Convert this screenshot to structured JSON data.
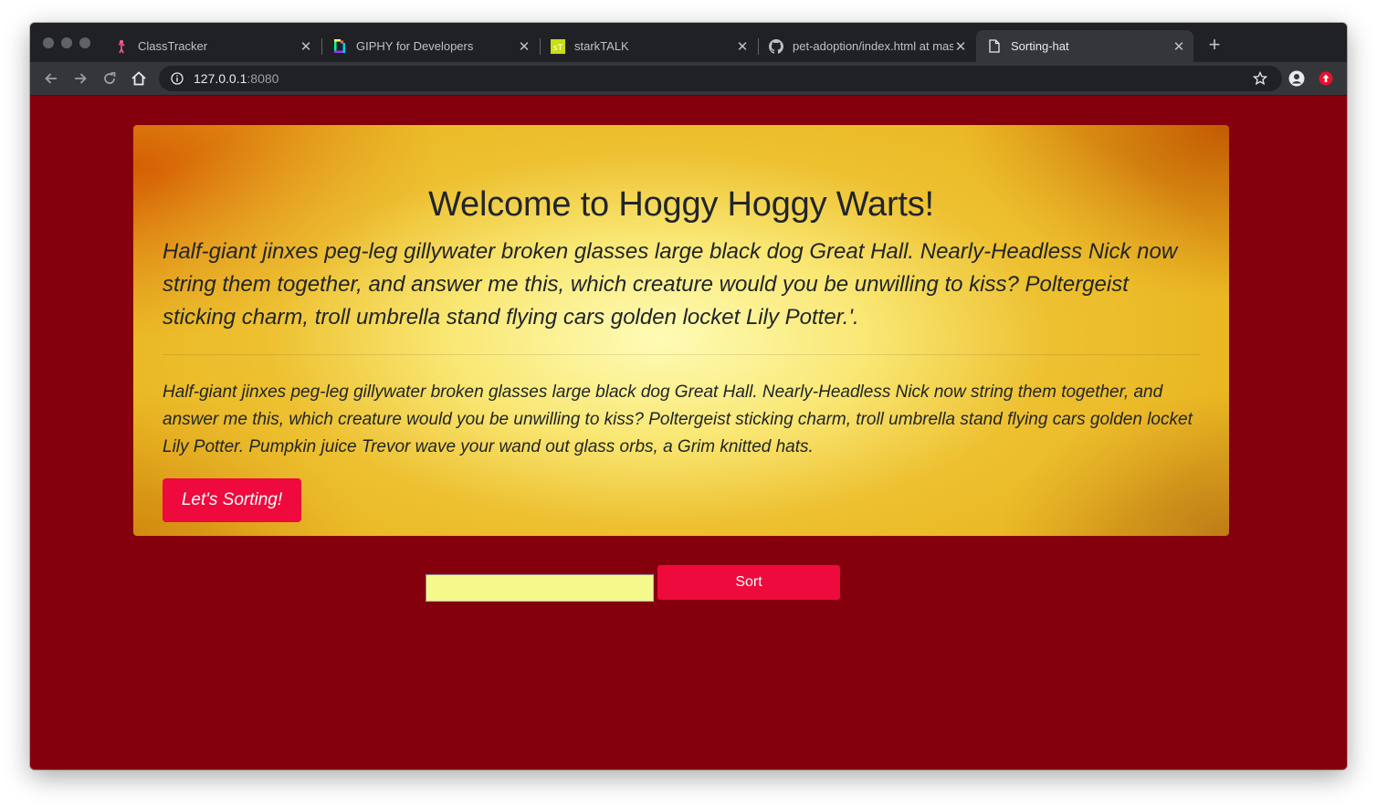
{
  "browser": {
    "tabs": [
      {
        "title": "ClassTracker",
        "icon": "flamingo-icon",
        "active": false
      },
      {
        "title": "GIPHY for Developers",
        "icon": "giphy-icon",
        "active": false
      },
      {
        "title": "starkTALK",
        "icon": "starktalk-icon",
        "icon_text": "sT",
        "active": false
      },
      {
        "title": "pet-adoption/index.html at master",
        "icon": "github-icon",
        "active": false
      },
      {
        "title": "Sorting-hat",
        "icon": "document-icon",
        "active": true
      }
    ],
    "url_host": "127.0.0.1",
    "url_port": ":8080"
  },
  "colors": {
    "page_background": "#85000d",
    "button": "#ee0a3c",
    "input_background": "#f5f88a"
  },
  "jumbotron": {
    "title": "Welcome to Hoggy Hoggy Warts!",
    "lead": "Half-giant jinxes peg-leg gillywater broken glasses large black dog Great Hall. Nearly-Headless Nick now string them together, and answer me this, which creature would you be unwilling to kiss? Poltergeist sticking charm, troll umbrella stand flying cars golden locket Lily Potter.'.",
    "body": "Half-giant jinxes peg-leg gillywater broken glasses large black dog Great Hall. Nearly-Headless Nick now string them together, and answer me this, which creature would you be unwilling to kiss? Poltergeist sticking charm, troll umbrella stand flying cars golden locket Lily Potter. Pumpkin juice Trevor wave your wand out glass orbs, a Grim knitted hats.",
    "button_label": "Let's Sorting!"
  },
  "sort_form": {
    "input_value": "",
    "button_label": "Sort"
  }
}
